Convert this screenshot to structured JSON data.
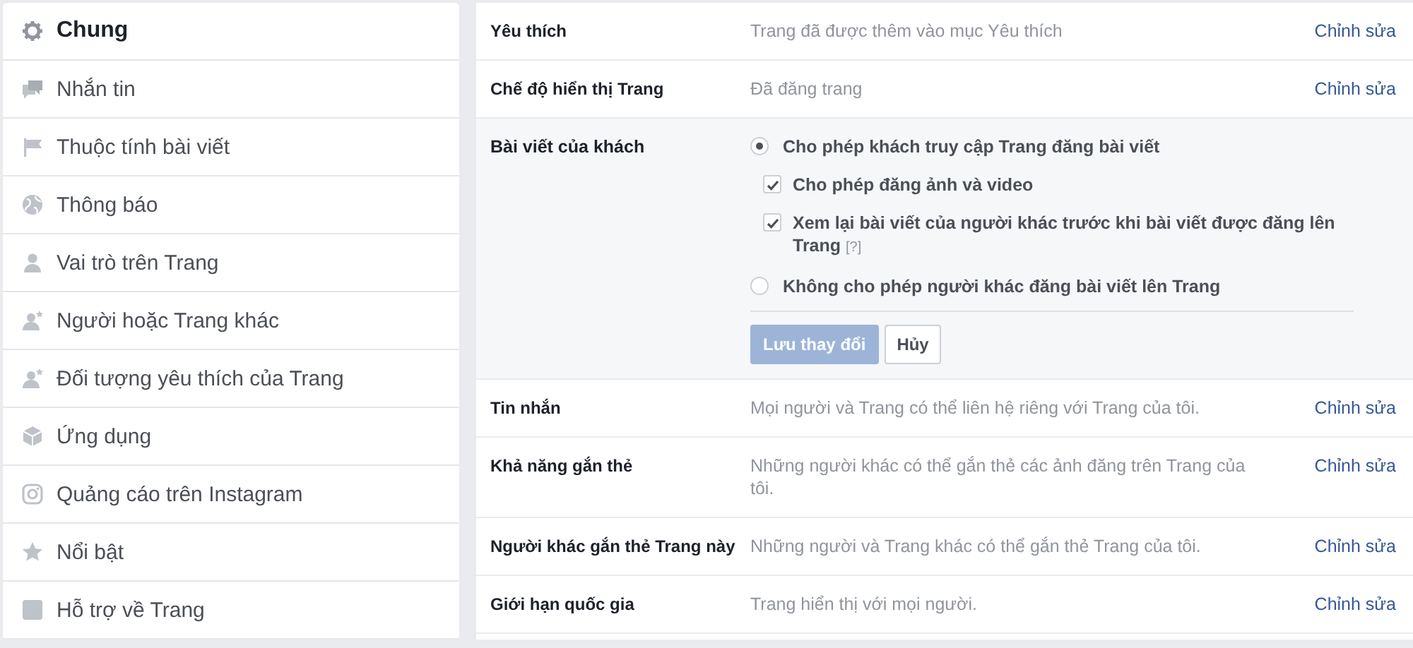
{
  "sidebar": {
    "items": [
      {
        "label": "Chung",
        "selected": true
      },
      {
        "label": "Nhắn tin",
        "selected": false
      },
      {
        "label": "Thuộc tính bài viết",
        "selected": false
      },
      {
        "label": "Thông báo",
        "selected": false
      },
      {
        "label": "Vai trò trên Trang",
        "selected": false
      },
      {
        "label": "Người hoặc Trang khác",
        "selected": false
      },
      {
        "label": "Đối tượng yêu thích của Trang",
        "selected": false
      },
      {
        "label": "Ứng dụng",
        "selected": false
      },
      {
        "label": "Quảng cáo trên Instagram",
        "selected": false
      },
      {
        "label": "Nổi bật",
        "selected": false
      },
      {
        "label": "Hỗ trợ về Trang",
        "selected": false
      }
    ]
  },
  "settings": [
    {
      "kind": "summary",
      "label": "Yêu thích",
      "value": "Trang đã được thêm vào mục Yêu thích",
      "edit": "Chỉnh sửa"
    },
    {
      "kind": "summary",
      "label": "Chế độ hiển thị Trang",
      "value": "Đã đăng trang",
      "edit": "Chỉnh sửa"
    },
    {
      "kind": "expanded",
      "label": "Bài viết của khách",
      "options": [
        {
          "kind": "radio",
          "label": "Cho phép khách truy cập Trang đăng bài viết",
          "selected": true,
          "children": [
            {
              "kind": "checkbox",
              "label": "Cho phép đăng ảnh và video",
              "checked": true
            },
            {
              "kind": "checkbox",
              "label": "Xem lại bài viết của người khác trước khi bài viết được đăng lên Trang",
              "help": "[?]",
              "checked": true
            }
          ]
        },
        {
          "kind": "radio",
          "label": "Không cho phép người khác đăng bài viết lên Trang",
          "selected": false
        }
      ],
      "save": {
        "label": "Lưu thay đổi",
        "disabled": true
      },
      "cancel": "Hủy"
    },
    {
      "kind": "summary",
      "label": "Tin nhắn",
      "value": "Mọi người và Trang có thể liên hệ riêng với Trang của tôi.",
      "edit": "Chỉnh sửa"
    },
    {
      "kind": "summary",
      "label": "Khả năng gắn thẻ",
      "value": "Những người khác có thể gắn thẻ các ảnh đăng trên Trang của tôi.",
      "edit": "Chỉnh sửa"
    },
    {
      "kind": "summary",
      "label": "Người khác gắn thẻ Trang này",
      "value": "Những người và Trang khác có thể gắn thẻ Trang của tôi.",
      "edit": "Chỉnh sửa"
    },
    {
      "kind": "summary",
      "label": "Giới hạn quốc gia",
      "value": "Trang hiển thị với mọi người.",
      "edit": "Chỉnh sửa"
    }
  ]
}
